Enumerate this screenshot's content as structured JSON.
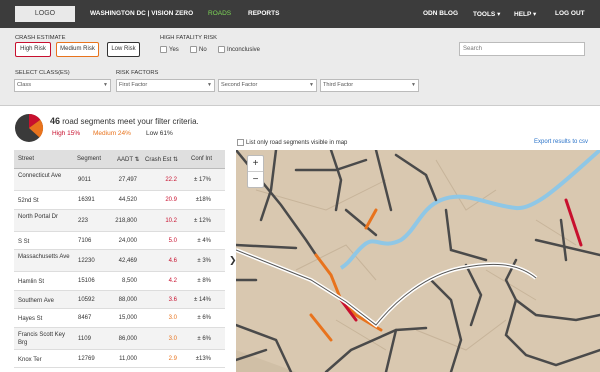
{
  "header": {
    "logo": "LOGO",
    "brand": "WASHINGTON DC  |  VISION ZERO",
    "nav": {
      "roads": "ROADS",
      "reports": "REPORTS",
      "odn_blog": "ODN BLOG",
      "tools": "TOOLS ▾",
      "help": "HELP ▾",
      "logout": "LOG OUT"
    }
  },
  "filters": {
    "crash_estimate_label": "CRASH ESTIMATE",
    "high_risk": "High Risk",
    "medium_risk": "Medium Risk",
    "low_risk": "Low Risk",
    "high_fatality_label": "HIGH FATALITY RISK",
    "yes": "Yes",
    "no": "No",
    "inconclusive": "Inconclusive",
    "search_placeholder": "Search",
    "select_class_label": "SELECT CLASS(ES)",
    "class_placeholder": "Class",
    "risk_factors_label": "RISK FACTORS",
    "first_factor": "First Factor",
    "second_factor": "Second Factor",
    "third_factor": "Third Factor"
  },
  "summary": {
    "count": "46",
    "text": " road segments meet your filter criteria.",
    "high": "High  15%",
    "medium": "Medium  24%",
    "low": "Low  61%"
  },
  "pie": {
    "high": 15,
    "medium": 24,
    "low": 61
  },
  "colors": {
    "high": "#c8102e",
    "medium": "#e8731d",
    "low": "#3a3a3a",
    "accent": "#7ed957",
    "link": "#2a73c9"
  },
  "table": {
    "headers": {
      "street": "Street",
      "segment": "Segment",
      "aadt": "AADT ⇅",
      "crash": "Crash Est ⇅",
      "conf": "Conf Int"
    },
    "rows": [
      {
        "street": "Connecticut Ave",
        "segment": "9011",
        "aadt": "27,497",
        "crash": "22.2",
        "conf": "± 17%",
        "level": "high"
      },
      {
        "street": "52nd St",
        "segment": "16391",
        "aadt": "44,520",
        "crash": "20.9",
        "conf": "±18%",
        "level": "high"
      },
      {
        "street": "North Portal Dr",
        "segment": "223",
        "aadt": "218,800",
        "crash": "10.2",
        "conf": "± 12%",
        "level": "high"
      },
      {
        "street": "S St",
        "segment": "7106",
        "aadt": "24,000",
        "crash": "5.0",
        "conf": "± 4%",
        "level": "high"
      },
      {
        "street": "Massachusetts Ave",
        "segment": "12230",
        "aadt": "42,469",
        "crash": "4.6",
        "conf": "± 3%",
        "level": "high"
      },
      {
        "street": "Hamlin St",
        "segment": "15106",
        "aadt": "8,500",
        "crash": "4.2",
        "conf": "± 8%",
        "level": "high"
      },
      {
        "street": "Southern Ave",
        "segment": "10592",
        "aadt": "88,000",
        "crash": "3.6",
        "conf": "± 14%",
        "level": "high"
      },
      {
        "street": "Hayes St",
        "segment": "8467",
        "aadt": "15,000",
        "crash": "3.0",
        "conf": "± 6%",
        "level": "med"
      },
      {
        "street": "Francis Scott Key Brg",
        "segment": "1109",
        "aadt": "86,000",
        "crash": "3.0",
        "conf": "± 6%",
        "level": "med"
      },
      {
        "street": "Knox Ter",
        "segment": "12769",
        "aadt": "11,000",
        "crash": "2.9",
        "conf": "±13%",
        "level": "med"
      }
    ]
  },
  "map": {
    "list_only": "List only road segments visible in map",
    "export": "Export results to csv",
    "zoom_in": "+",
    "zoom_out": "−"
  },
  "collapse_arrow": "❯"
}
